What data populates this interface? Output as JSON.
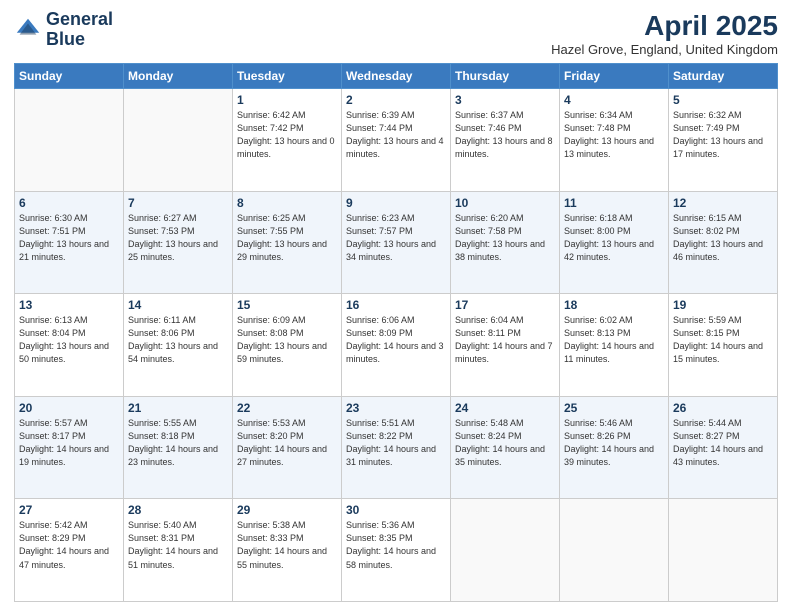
{
  "header": {
    "logo_line1": "General",
    "logo_line2": "Blue",
    "month_title": "April 2025",
    "location": "Hazel Grove, England, United Kingdom"
  },
  "weekdays": [
    "Sunday",
    "Monday",
    "Tuesday",
    "Wednesday",
    "Thursday",
    "Friday",
    "Saturday"
  ],
  "weeks": [
    [
      {
        "day": "",
        "info": ""
      },
      {
        "day": "",
        "info": ""
      },
      {
        "day": "1",
        "info": "Sunrise: 6:42 AM\nSunset: 7:42 PM\nDaylight: 13 hours and 0 minutes."
      },
      {
        "day": "2",
        "info": "Sunrise: 6:39 AM\nSunset: 7:44 PM\nDaylight: 13 hours and 4 minutes."
      },
      {
        "day": "3",
        "info": "Sunrise: 6:37 AM\nSunset: 7:46 PM\nDaylight: 13 hours and 8 minutes."
      },
      {
        "day": "4",
        "info": "Sunrise: 6:34 AM\nSunset: 7:48 PM\nDaylight: 13 hours and 13 minutes."
      },
      {
        "day": "5",
        "info": "Sunrise: 6:32 AM\nSunset: 7:49 PM\nDaylight: 13 hours and 17 minutes."
      }
    ],
    [
      {
        "day": "6",
        "info": "Sunrise: 6:30 AM\nSunset: 7:51 PM\nDaylight: 13 hours and 21 minutes."
      },
      {
        "day": "7",
        "info": "Sunrise: 6:27 AM\nSunset: 7:53 PM\nDaylight: 13 hours and 25 minutes."
      },
      {
        "day": "8",
        "info": "Sunrise: 6:25 AM\nSunset: 7:55 PM\nDaylight: 13 hours and 29 minutes."
      },
      {
        "day": "9",
        "info": "Sunrise: 6:23 AM\nSunset: 7:57 PM\nDaylight: 13 hours and 34 minutes."
      },
      {
        "day": "10",
        "info": "Sunrise: 6:20 AM\nSunset: 7:58 PM\nDaylight: 13 hours and 38 minutes."
      },
      {
        "day": "11",
        "info": "Sunrise: 6:18 AM\nSunset: 8:00 PM\nDaylight: 13 hours and 42 minutes."
      },
      {
        "day": "12",
        "info": "Sunrise: 6:15 AM\nSunset: 8:02 PM\nDaylight: 13 hours and 46 minutes."
      }
    ],
    [
      {
        "day": "13",
        "info": "Sunrise: 6:13 AM\nSunset: 8:04 PM\nDaylight: 13 hours and 50 minutes."
      },
      {
        "day": "14",
        "info": "Sunrise: 6:11 AM\nSunset: 8:06 PM\nDaylight: 13 hours and 54 minutes."
      },
      {
        "day": "15",
        "info": "Sunrise: 6:09 AM\nSunset: 8:08 PM\nDaylight: 13 hours and 59 minutes."
      },
      {
        "day": "16",
        "info": "Sunrise: 6:06 AM\nSunset: 8:09 PM\nDaylight: 14 hours and 3 minutes."
      },
      {
        "day": "17",
        "info": "Sunrise: 6:04 AM\nSunset: 8:11 PM\nDaylight: 14 hours and 7 minutes."
      },
      {
        "day": "18",
        "info": "Sunrise: 6:02 AM\nSunset: 8:13 PM\nDaylight: 14 hours and 11 minutes."
      },
      {
        "day": "19",
        "info": "Sunrise: 5:59 AM\nSunset: 8:15 PM\nDaylight: 14 hours and 15 minutes."
      }
    ],
    [
      {
        "day": "20",
        "info": "Sunrise: 5:57 AM\nSunset: 8:17 PM\nDaylight: 14 hours and 19 minutes."
      },
      {
        "day": "21",
        "info": "Sunrise: 5:55 AM\nSunset: 8:18 PM\nDaylight: 14 hours and 23 minutes."
      },
      {
        "day": "22",
        "info": "Sunrise: 5:53 AM\nSunset: 8:20 PM\nDaylight: 14 hours and 27 minutes."
      },
      {
        "day": "23",
        "info": "Sunrise: 5:51 AM\nSunset: 8:22 PM\nDaylight: 14 hours and 31 minutes."
      },
      {
        "day": "24",
        "info": "Sunrise: 5:48 AM\nSunset: 8:24 PM\nDaylight: 14 hours and 35 minutes."
      },
      {
        "day": "25",
        "info": "Sunrise: 5:46 AM\nSunset: 8:26 PM\nDaylight: 14 hours and 39 minutes."
      },
      {
        "day": "26",
        "info": "Sunrise: 5:44 AM\nSunset: 8:27 PM\nDaylight: 14 hours and 43 minutes."
      }
    ],
    [
      {
        "day": "27",
        "info": "Sunrise: 5:42 AM\nSunset: 8:29 PM\nDaylight: 14 hours and 47 minutes."
      },
      {
        "day": "28",
        "info": "Sunrise: 5:40 AM\nSunset: 8:31 PM\nDaylight: 14 hours and 51 minutes."
      },
      {
        "day": "29",
        "info": "Sunrise: 5:38 AM\nSunset: 8:33 PM\nDaylight: 14 hours and 55 minutes."
      },
      {
        "day": "30",
        "info": "Sunrise: 5:36 AM\nSunset: 8:35 PM\nDaylight: 14 hours and 58 minutes."
      },
      {
        "day": "",
        "info": ""
      },
      {
        "day": "",
        "info": ""
      },
      {
        "day": "",
        "info": ""
      }
    ]
  ]
}
